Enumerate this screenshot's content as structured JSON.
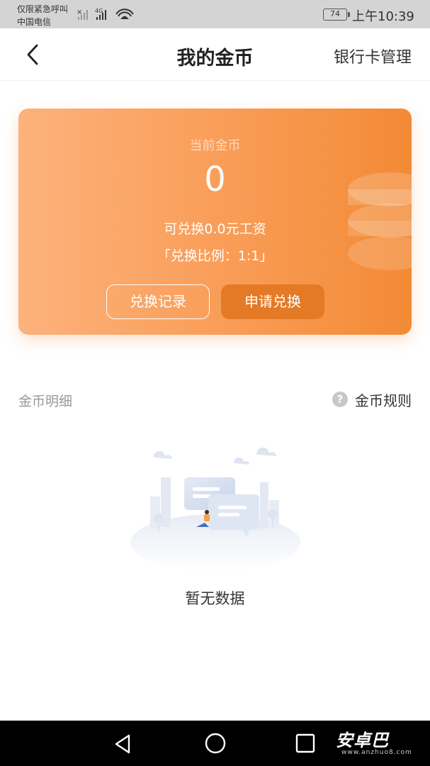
{
  "status_bar": {
    "line1": "仅限紧急呼叫",
    "line2": "中国电信",
    "network": "4G",
    "battery": "74",
    "time": "上午10:39"
  },
  "header": {
    "title": "我的金币",
    "right_link": "银行卡管理"
  },
  "card": {
    "label": "当前金币",
    "value": "0",
    "exchange_text": "可兑换0.0元工资",
    "ratio_text": "「兑换比例：1:1」",
    "record_button": "兑换记录",
    "apply_button": "申请兑换"
  },
  "details": {
    "section_label": "金币明细",
    "rules_label": "金币规则",
    "empty_text": "暂无数据"
  },
  "watermark": {
    "brand": "安卓巴",
    "url": "www.anzhuo8.com"
  }
}
